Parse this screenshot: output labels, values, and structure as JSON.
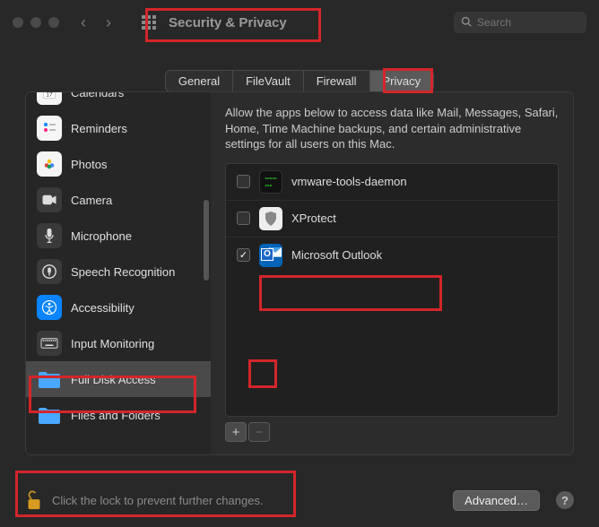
{
  "window": {
    "title": "Security & Privacy",
    "search_placeholder": "Search"
  },
  "tabs": {
    "general": "General",
    "filevault": "FileVault",
    "firewall": "Firewall",
    "privacy": "Privacy",
    "active": "privacy"
  },
  "sidebar": {
    "items": [
      {
        "icon": "calendar",
        "label": "Calendars"
      },
      {
        "icon": "reminders",
        "label": "Reminders"
      },
      {
        "icon": "photos",
        "label": "Photos"
      },
      {
        "icon": "camera",
        "label": "Camera"
      },
      {
        "icon": "microphone",
        "label": "Microphone"
      },
      {
        "icon": "speech",
        "label": "Speech Recognition"
      },
      {
        "icon": "accessibility",
        "label": "Accessibility"
      },
      {
        "icon": "keyboard",
        "label": "Input Monitoring"
      },
      {
        "icon": "folder",
        "label": "Full Disk Access",
        "selected": true
      },
      {
        "icon": "folder",
        "label": "Files and Folders"
      }
    ]
  },
  "content": {
    "description": "Allow the apps below to access data like Mail, Messages, Safari, Home, Time Machine backups, and certain administrative settings for all users on this Mac.",
    "apps": [
      {
        "name": "vmware-tools-daemon",
        "checked": false,
        "icon": "terminal"
      },
      {
        "name": "XProtect",
        "checked": false,
        "icon": "shield"
      },
      {
        "name": "Microsoft Outlook",
        "checked": true,
        "icon": "outlook"
      }
    ],
    "add_label": "+",
    "remove_label": "−"
  },
  "footer": {
    "lock_text": "Click the lock to prevent further changes.",
    "advanced_label": "Advanced…",
    "help_label": "?"
  }
}
